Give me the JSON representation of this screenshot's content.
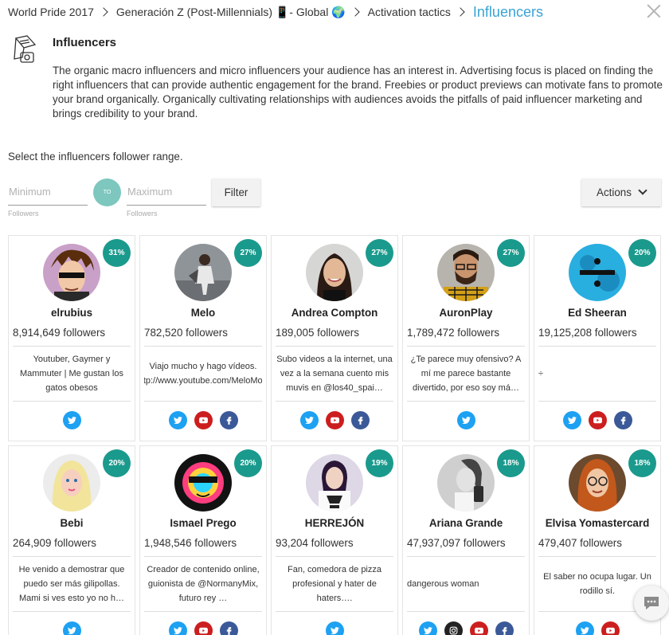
{
  "breadcrumb": [
    "World Pride 2017",
    "Generación Z (Post-Millennials) 📱- Global 🌍",
    "Activation tactics",
    "Influencers"
  ],
  "section": {
    "title": "Influencers",
    "description": "The organic macro influencers and micro influencers your audience has an interest in. Advertising focus is placed on finding the right influencers that can provide authentic engagement for the brand. Freebies or product previews can motivate fans to promote your brand organically. Organically cultivating relationships with audiences avoids the pitfalls of paid influencer marketing and brings credibility to your brand."
  },
  "filter": {
    "label": "Select the influencers follower range.",
    "min_placeholder": "Minimum",
    "max_placeholder": "Maximum",
    "min_sub": "Followers",
    "max_sub": "Followers",
    "to_label": "TO",
    "filter_button": "Filter",
    "actions_button": "Actions"
  },
  "influencers": [
    {
      "pct": "31%",
      "name": "elrubius",
      "followers": "8,914,649 followers",
      "bio": "Youtuber, Gaymer y Mammuter | Me gustan los gatos obesos",
      "socials": [
        "twitter"
      ],
      "avatar": "cartoon-avatar"
    },
    {
      "pct": "27%",
      "name": "Melo",
      "followers": "782,520 followers",
      "bio": "Viajo mucho y hago vídeos. http://www.youtube.com/MeloMore",
      "socials": [
        "twitter",
        "youtube",
        "facebook"
      ],
      "avatar": "street-photo"
    },
    {
      "pct": "27%",
      "name": "Andrea Compton",
      "followers": "189,005 followers",
      "bio": "Subo videos a la internet, una vez a la semana cuento mis muvis en @los40_spai…",
      "socials": [
        "twitter",
        "youtube",
        "facebook"
      ],
      "avatar": "portrait-woman"
    },
    {
      "pct": "27%",
      "name": "AuronPlay",
      "followers": "1,789,472 followers",
      "bio": "¿Te parece muy ofensivo? A mí me parece bastante divertido, por eso soy má…",
      "socials": [
        "twitter"
      ],
      "avatar": "portrait-man-glasses"
    },
    {
      "pct": "20%",
      "name": "Ed Sheeran",
      "followers": "19,125,208 followers",
      "bio": "÷",
      "socials": [
        "twitter",
        "youtube",
        "facebook"
      ],
      "avatar": "divide-album"
    },
    {
      "pct": "20%",
      "name": "Bebi",
      "followers": "264,909 followers",
      "bio": "He venido a demostrar que puedo ser más gilipollas. Mami si ves esto yo no h…",
      "socials": [
        "twitter"
      ],
      "avatar": "doll"
    },
    {
      "pct": "20%",
      "name": "Ismael Prego",
      "followers": "1,948,546 followers",
      "bio": "Creador de contenido online, guionista de @NormanyMix, futuro rey …",
      "socials": [
        "twitter",
        "youtube",
        "facebook"
      ],
      "avatar": "psychedelic"
    },
    {
      "pct": "19%",
      "name": "HERREJÓN",
      "followers": "93,204 followers",
      "bio": "Fan, comedora de pizza profesional y hater de haters….",
      "socials": [
        "twitter"
      ],
      "avatar": "stormtrooper"
    },
    {
      "pct": "18%",
      "name": "Ariana Grande",
      "followers": "47,937,097 followers",
      "bio": "dangerous woman",
      "socials": [
        "twitter",
        "instagram",
        "youtube",
        "facebook"
      ],
      "avatar": "bw-portrait"
    },
    {
      "pct": "18%",
      "name": "Elvisa Yomastercard",
      "followers": "479,407 followers",
      "bio": "El saber no ocupa lugar. Un rodillo sí.",
      "socials": [
        "twitter",
        "youtube"
      ],
      "avatar": "redhead-glasses"
    }
  ],
  "colors": {
    "accent": "#39a3d6",
    "percent_badge": "#1a9a8d",
    "to_badge": "#7dc7bf"
  }
}
